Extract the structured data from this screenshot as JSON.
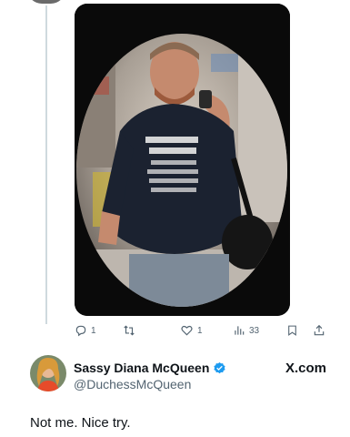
{
  "tweet_actions": {
    "replies": "1",
    "retweets": "",
    "likes": "1",
    "views": "33"
  },
  "media": {
    "shirt_text": [
      "I DON'T",
      "NEED TEA",
      "TO SLEEP.",
      "I DON'T",
      "NEED ANY",
      "HEADSTART"
    ]
  },
  "reply": {
    "author_name": "Sassy Diana McQueen",
    "author_handle": "@DuchessMcQueen",
    "brand": "X.com",
    "text": "Not me. Nice try."
  },
  "colors": {
    "verified": "#1d9bf0",
    "muted": "#536471",
    "thread_line": "#cfd9de"
  },
  "icons": [
    "reply-icon",
    "retweet-icon",
    "like-icon",
    "views-icon",
    "bookmark-icon",
    "share-icon",
    "verified-badge-icon",
    "x-logo-icon"
  ]
}
